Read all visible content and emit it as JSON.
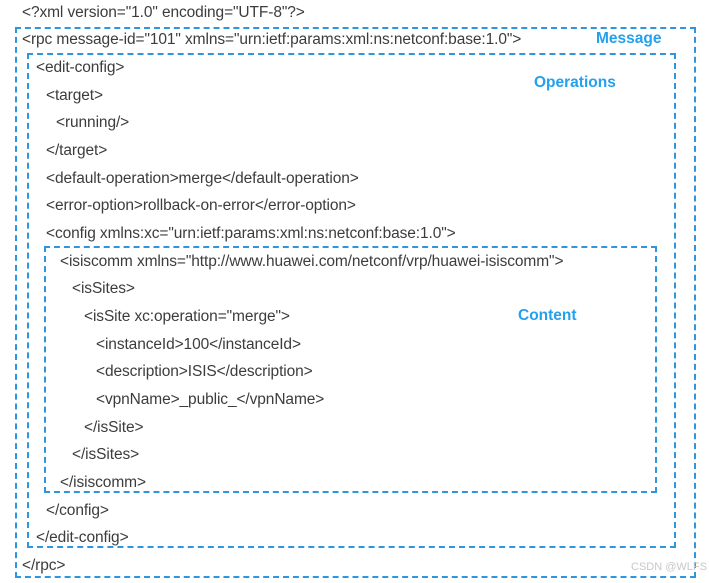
{
  "diagram": {
    "title": "NETCONF edit-config RPC message structure",
    "accent_color": "#23a0ee",
    "border_color": "#2d96e0",
    "text_color": "#3c3c3c",
    "watermark": "CSDN @WLFS"
  },
  "labels": {
    "message": "Message",
    "operations": "Operations",
    "content": "Content"
  },
  "code": {
    "xml_declaration": "<?xml version=\"1.0\" encoding=\"UTF-8\"?>",
    "lines": [
      {
        "id": "rpc-open",
        "text": "<rpc message-id=\"101\" xmlns=\"urn:ietf:params:xml:ns:netconf:base:1.0\">"
      },
      {
        "id": "edit-config-open",
        "text": "<edit-config>"
      },
      {
        "id": "target-open",
        "text": "<target>"
      },
      {
        "id": "running",
        "text": "<running/>"
      },
      {
        "id": "target-close",
        "text": "</target>"
      },
      {
        "id": "default-operation",
        "text": "<default-operation>merge</default-operation>"
      },
      {
        "id": "error-option",
        "text": "<error-option>rollback-on-error</error-option>"
      },
      {
        "id": "config-open",
        "text": "<config xmlns:xc=\"urn:ietf:params:xml:ns:netconf:base:1.0\">"
      },
      {
        "id": "isiscomm-open",
        "text": "<isiscomm xmlns=\"http://www.huawei.com/netconf/vrp/huawei-isiscomm\">"
      },
      {
        "id": "issites-open",
        "text": "<isSites>"
      },
      {
        "id": "issite-open",
        "text": "<isSite xc:operation=\"merge\">"
      },
      {
        "id": "instance-id",
        "text": "<instanceId>100</instanceId>"
      },
      {
        "id": "description",
        "text": "<description>ISIS</description>"
      },
      {
        "id": "vpn-name",
        "text": "<vpnName>_public_</vpnName>"
      },
      {
        "id": "issite-close",
        "text": "</isSite>"
      },
      {
        "id": "issites-close",
        "text": "</isSites>"
      },
      {
        "id": "isiscomm-close",
        "text": "</isiscomm>"
      },
      {
        "id": "config-close",
        "text": "</config>"
      },
      {
        "id": "edit-config-close",
        "text": "</edit-config>"
      },
      {
        "id": "rpc-close",
        "text": "</rpc>"
      }
    ]
  }
}
